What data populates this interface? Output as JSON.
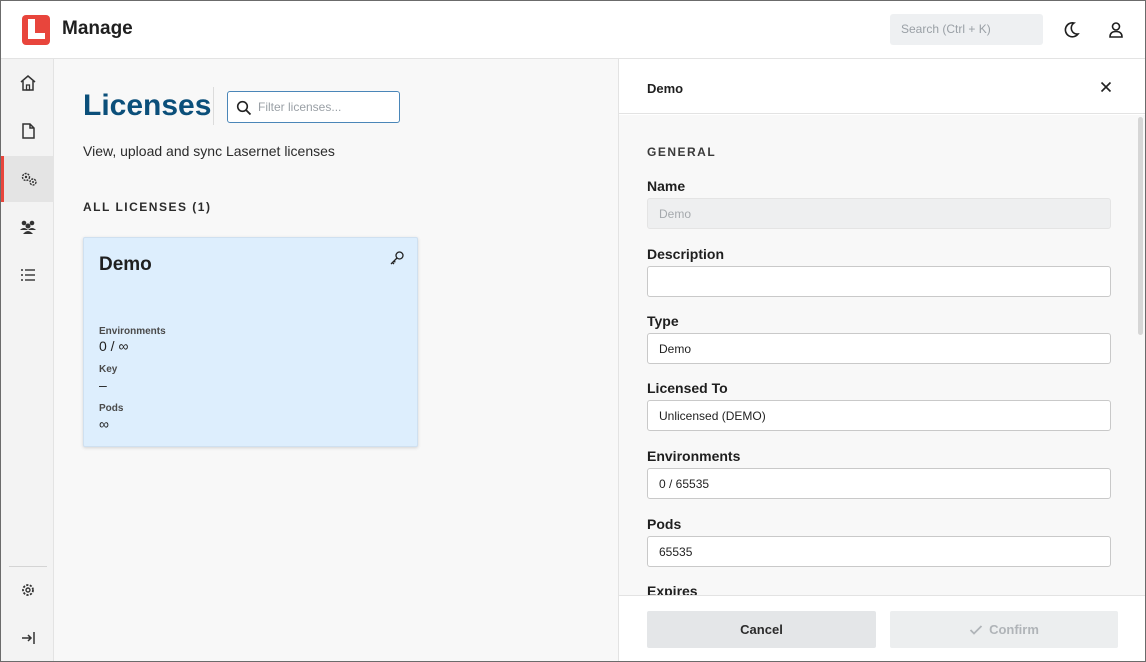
{
  "app": {
    "title": "Manage",
    "search_placeholder": "Search (Ctrl + K)",
    "brand_color": "#e8453c",
    "title_color": "#0b4f7a"
  },
  "sidebar": {
    "items": [
      {
        "icon": "home-icon",
        "active": false
      },
      {
        "icon": "document-icon",
        "active": false
      },
      {
        "icon": "gears-icon",
        "active": true
      },
      {
        "icon": "users-icon",
        "active": false
      },
      {
        "icon": "list-icon",
        "active": false
      }
    ],
    "bottom_items": [
      {
        "icon": "settings-icon"
      },
      {
        "icon": "logout-icon"
      }
    ]
  },
  "main": {
    "title": "Licenses",
    "filter_placeholder": "Filter licenses...",
    "subtitle": "View, upload and sync Lasernet licenses",
    "section_label": "ALL LICENSES (1)",
    "card": {
      "title": "Demo",
      "fields": [
        {
          "label": "Environments",
          "value": "0 / ∞"
        },
        {
          "label": "Key",
          "value": "–"
        },
        {
          "label": "Pods",
          "value": "∞"
        }
      ]
    }
  },
  "panel": {
    "title": "Demo",
    "section": "GENERAL",
    "fields": [
      {
        "label": "Name",
        "value": "Demo",
        "disabled": true
      },
      {
        "label": "Description",
        "value": "",
        "disabled": false
      },
      {
        "label": "Type",
        "value": "Demo",
        "disabled": false
      },
      {
        "label": "Licensed To",
        "value": "Unlicensed (DEMO)",
        "disabled": false
      },
      {
        "label": "Environments",
        "value": "0 / 65535",
        "disabled": false
      },
      {
        "label": "Pods",
        "value": "65535",
        "disabled": false
      },
      {
        "label": "Expires",
        "value": "",
        "disabled": false
      }
    ],
    "cancel_label": "Cancel",
    "confirm_label": "Confirm"
  }
}
